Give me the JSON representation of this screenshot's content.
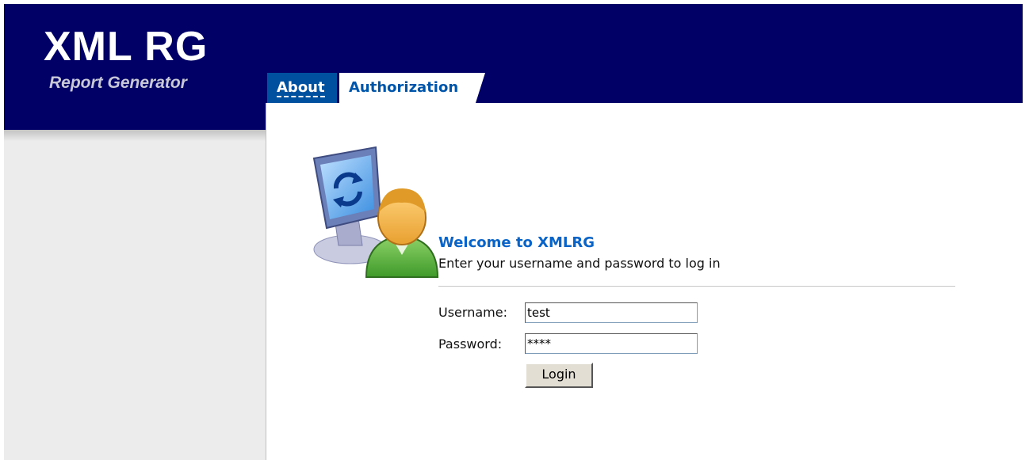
{
  "header": {
    "logo_title": "XML RG",
    "logo_subtitle": "Report Generator"
  },
  "tabs": [
    {
      "label": "About",
      "active": false
    },
    {
      "label": "Authorization",
      "active": true
    }
  ],
  "login": {
    "welcome_title": "Welcome to XMLRG",
    "welcome_subtitle": "Enter your username and password to log in",
    "username_label": "Username:",
    "username_value": "test",
    "password_label": "Password:",
    "password_value": "****",
    "login_button_label": "Login"
  },
  "colors": {
    "header_bg": "#000066",
    "active_tab_text": "#0055aa",
    "inactive_tab_bg": "#0050a0",
    "welcome_title": "#0a64c8",
    "sidebar_bg": "#ececec"
  },
  "icons": {
    "illustration": "user-computer-login-icon"
  }
}
